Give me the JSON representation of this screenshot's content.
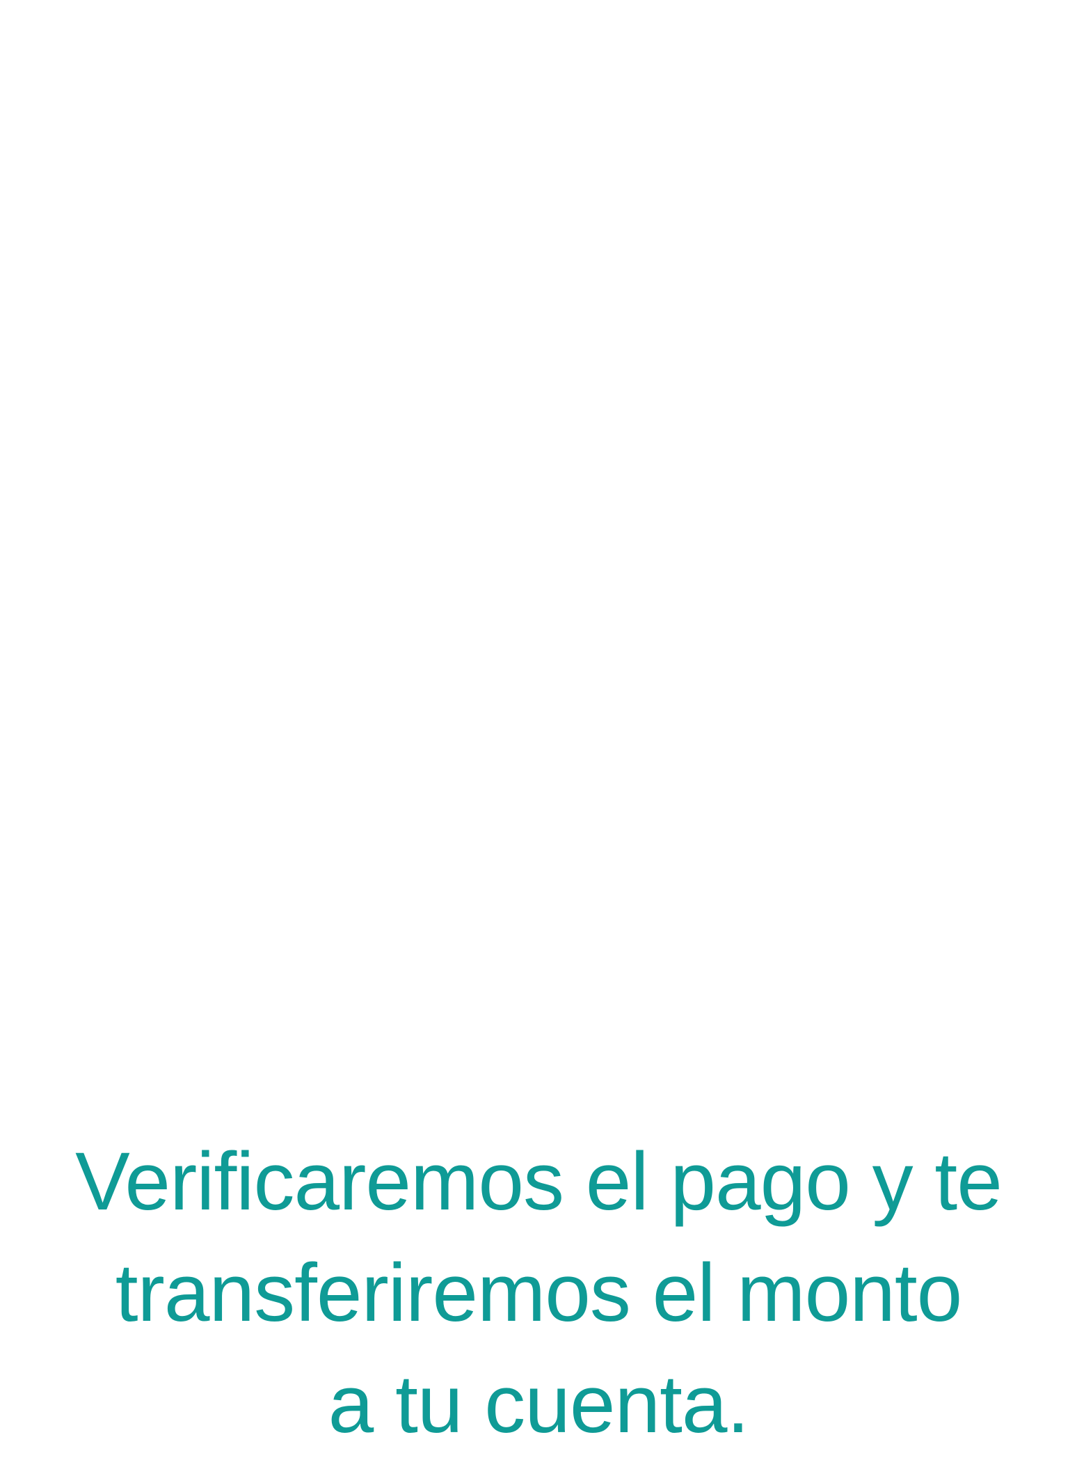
{
  "message": {
    "lines": [
      "Verificaremos el pago y te",
      "transferiremos el monto",
      "a tu cuenta."
    ],
    "color": "#0f9b96"
  }
}
